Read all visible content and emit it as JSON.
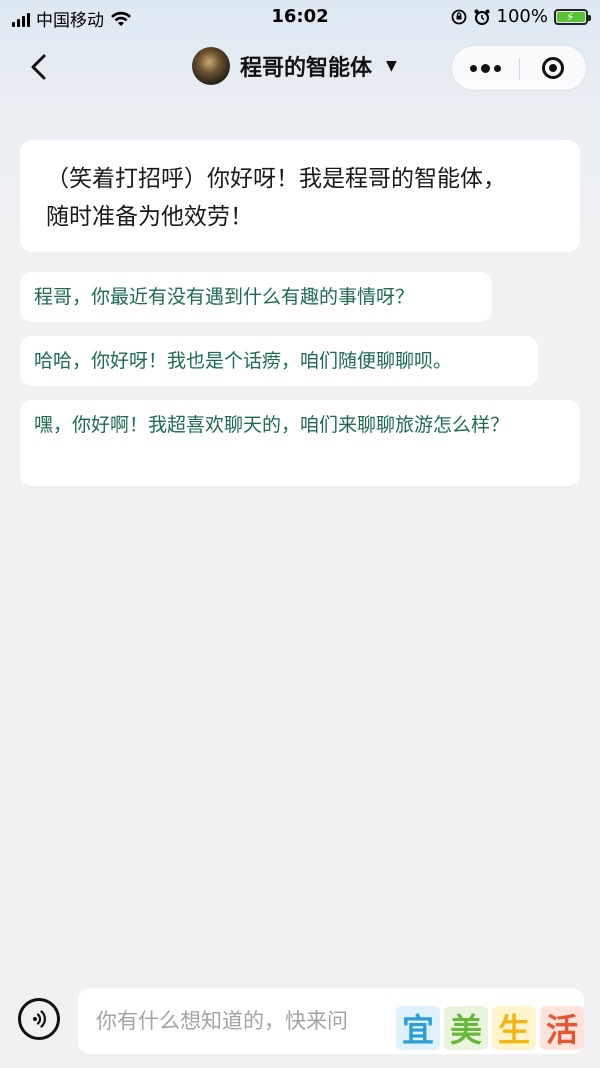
{
  "status_bar": {
    "carrier": "中国移动",
    "time": "16:02",
    "battery": "100%",
    "battery_level": 1.0,
    "icons": [
      "signal-icon",
      "wifi-icon",
      "lock-rotation-icon",
      "alarm-icon",
      "battery-charging-icon"
    ]
  },
  "nav": {
    "title": "程哥的智能体",
    "caret": "▼",
    "icons": [
      "back-arrow-icon",
      "avatar",
      "more-dots-icon",
      "target-close-icon"
    ]
  },
  "chat": {
    "greeting": "（笑着打招呼）你好呀！我是程哥的智能体，随时准备为他效劳！",
    "suggestions": [
      "程哥，你最近有没有遇到什么有趣的事情呀？",
      "哈哈，你好呀！我也是个话痨，咱们随便聊聊呗。",
      "嘿，你好啊！我超喜欢聊天的，咱们来聊聊旅游怎么样？"
    ]
  },
  "input": {
    "placeholder": "你有什么想知道的，快来问",
    "voice_icon": "voice-icon"
  },
  "watermark": {
    "chars": [
      "宜",
      "美",
      "生",
      "活"
    ],
    "colors": [
      "#2a9fd6",
      "#67b83a",
      "#f2b615",
      "#e8542f"
    ],
    "bg_colors": [
      "#dff1fb",
      "#e8f5dc",
      "#fff4cc",
      "#fde3dc"
    ]
  },
  "colors": {
    "suggestion_text": "#1e6b55",
    "background": "#f1f1f3"
  }
}
